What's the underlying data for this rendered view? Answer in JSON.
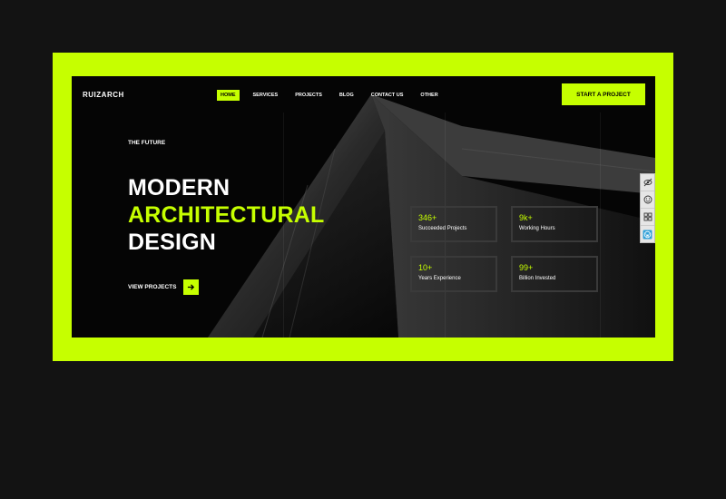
{
  "brand": {
    "logo": "RUIZARCH"
  },
  "nav": {
    "items": [
      {
        "label": "HOME",
        "active": true
      },
      {
        "label": "SERVICES",
        "active": false
      },
      {
        "label": "PROJECTS",
        "active": false
      },
      {
        "label": "BLOG",
        "active": false
      },
      {
        "label": "CONTACT US",
        "active": false
      },
      {
        "label": "OTHER",
        "active": false
      }
    ],
    "cta_label": "START A PROJECT"
  },
  "hero": {
    "eyebrow": "THE FUTURE",
    "line1": "MODERN",
    "line2": "ARCHITECTURAL",
    "line3": "DESIGN",
    "view_projects_label": "VIEW PROJECTS"
  },
  "stats": [
    {
      "value": "346+",
      "label": "Succeeded Projects"
    },
    {
      "value": "9k+",
      "label": "Working Hours"
    },
    {
      "value": "10+",
      "label": "Years Experience"
    },
    {
      "value": "99+",
      "label": "Billion Invested"
    }
  ],
  "side_tools": [
    "eye-slash-icon",
    "smile-icon",
    "grid-icon",
    "wordpress-icon"
  ],
  "colors": {
    "accent": "#c6ff00",
    "background": "#131313",
    "screen": "#050505"
  }
}
